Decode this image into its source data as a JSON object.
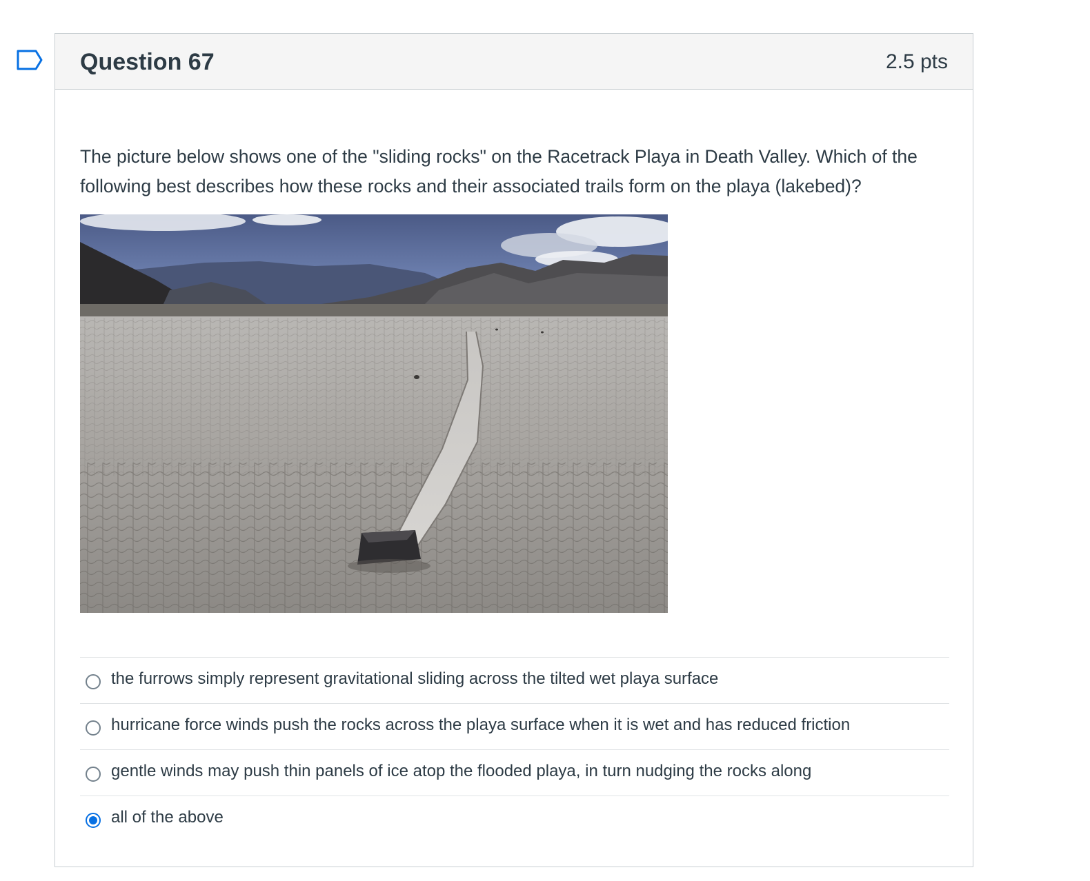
{
  "question": {
    "title": "Question 67",
    "points": "2.5 pts",
    "text": "The picture below shows one of the \"sliding rocks\" on the Racetrack Playa in Death Valley. Which of the following best describes how these rocks and their associated trails form on the playa (lakebed)?"
  },
  "answers": [
    {
      "label": "the furrows simply represent gravitational sliding across the tilted wet playa surface",
      "selected": false
    },
    {
      "label": "hurricane force winds push the rocks across the playa surface when it is wet and has reduced friction",
      "selected": false
    },
    {
      "label": "gentle winds may push thin panels of ice atop the flooded playa, in turn nudging the rocks along",
      "selected": false
    },
    {
      "label": "all of the above",
      "selected": true
    }
  ],
  "colors": {
    "accent": "#0770e3",
    "text": "#2d3b45",
    "header_bg": "#f5f5f5",
    "border": "#c7cdd1"
  }
}
